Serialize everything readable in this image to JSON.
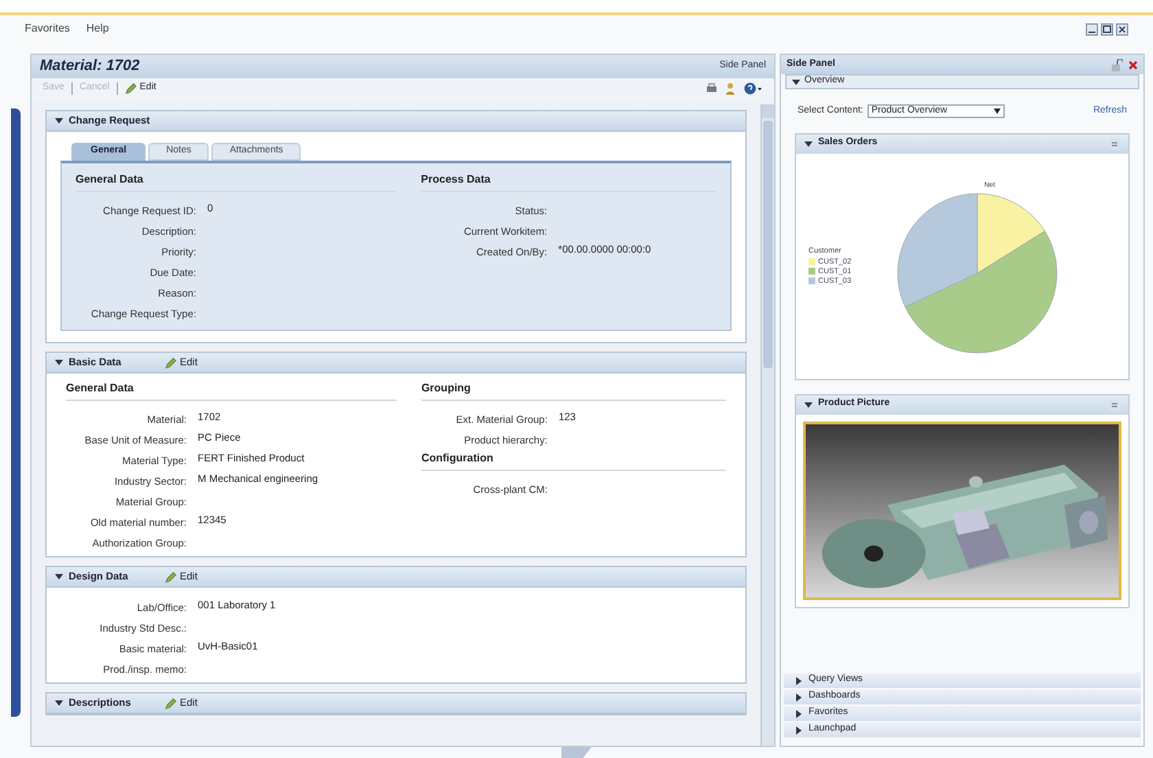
{
  "menu": [
    "Favorites",
    "Help"
  ],
  "main": {
    "title": "Material: 1702",
    "side_panel_link": "Side Panel",
    "toolbar": [
      {
        "label": "Save",
        "disabled": true
      },
      {
        "label": "Cancel",
        "disabled": true
      },
      {
        "label": "Edit",
        "disabled": false
      }
    ]
  },
  "sections": [
    {
      "title": "Change Request",
      "expanded": true,
      "tabs": [
        {
          "label": "General",
          "selected": true
        },
        {
          "label": "Notes",
          "selected": false
        },
        {
          "label": "Attachments",
          "selected": false
        }
      ],
      "columns": [
        [
          {
            "title": "General Data",
            "fields": [
              {
                "label": "Change Request ID:",
                "value": "0"
              },
              {
                "label": "Description:"
              },
              {
                "label": "Priority:"
              },
              {
                "label": "Due Date:"
              },
              {
                "label": "Reason:"
              },
              {
                "label": "Change Request Type:"
              }
            ]
          }
        ],
        [
          {
            "title": "Process Data",
            "fields": [
              {
                "label": "Status:"
              },
              {
                "label": "Current Workitem:"
              },
              {
                "label": "Created On/By:",
                "value": "*00.00.0000 00:00:0"
              }
            ]
          }
        ]
      ]
    },
    {
      "title": "Basic Data",
      "expanded": true,
      "edit": "Edit",
      "columns": [
        [
          {
            "title": "General Data",
            "fields": [
              {
                "label": "Material:",
                "value": "1702"
              },
              {
                "label": "Base Unit of Measure:",
                "value": "PC Piece"
              },
              {
                "label": "Material Type:",
                "value": "FERT Finished Product"
              },
              {
                "label": "Industry Sector:",
                "value": "M Mechanical engineering"
              },
              {
                "label": "Material Group:"
              },
              {
                "label": "Old material number:",
                "value": "12345"
              },
              {
                "label": "Authorization Group:"
              }
            ]
          }
        ],
        [
          {
            "title": "Grouping",
            "fields": [
              {
                "label": "Ext. Material Group:",
                "value": "123"
              },
              {
                "label": "Product hierarchy:"
              }
            ]
          },
          {
            "title": "Configuration",
            "fields": [
              {
                "label": "Cross-plant CM:"
              }
            ]
          }
        ]
      ]
    },
    {
      "title": "Design Data",
      "expanded": true,
      "edit": "Edit",
      "columns": [
        [
          {
            "fields": [
              {
                "label": "Lab/Office:",
                "value": "001 Laboratory 1"
              },
              {
                "label": "Industry Std Desc.:"
              },
              {
                "label": "Basic material:",
                "value": "UvH-Basic01"
              },
              {
                "label": "Prod./insp. memo:"
              }
            ]
          }
        ]
      ]
    },
    {
      "title": "Descriptions",
      "expanded": true,
      "edit": "Edit"
    }
  ],
  "side_panel": {
    "title": "Side Panel",
    "overview": {
      "title": "Overview",
      "expanded": true
    },
    "select_label": "Select Content:",
    "select_value": "Product Overview",
    "refresh": "Refresh",
    "sales_orders": {
      "title": "Sales Orders",
      "pie_label": "Net",
      "legend_title": "Customer",
      "legend": [
        {
          "name": "CUST_02",
          "color": "#f8f2a2"
        },
        {
          "name": "CUST_01",
          "color": "#a9cb8a"
        },
        {
          "name": "CUST_03",
          "color": "#b6c9dc"
        }
      ]
    },
    "product_picture": {
      "title": "Product Picture",
      "kind": "picture"
    },
    "accordion": [
      {
        "title": "Query Views",
        "expanded": false
      },
      {
        "title": "Dashboards",
        "expanded": false
      },
      {
        "title": "Favorites",
        "expanded": false
      },
      {
        "title": "Launchpad",
        "expanded": false
      }
    ]
  }
}
